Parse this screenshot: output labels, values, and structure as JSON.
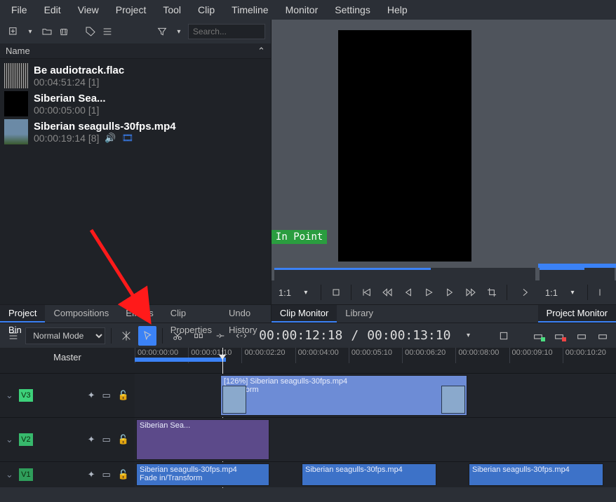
{
  "menu": [
    "File",
    "Edit",
    "View",
    "Project",
    "Tool",
    "Clip",
    "Timeline",
    "Monitor",
    "Settings",
    "Help"
  ],
  "search": {
    "placeholder": "Search..."
  },
  "bin_header": "Name",
  "clips": [
    {
      "name": "Be audiotrack.flac",
      "meta": "00:04:51:24 [1]",
      "type": "audio"
    },
    {
      "name": "Siberian Sea...",
      "meta": "00:00:05:00 [1]",
      "type": "video"
    },
    {
      "name": "Siberian seagulls-30fps.mp4",
      "meta": "00:00:19:14 [8]",
      "type": "video",
      "icons": true
    }
  ],
  "in_point": "In Point",
  "ratio_clip": "1:1",
  "ratio_proj": "1:1",
  "bin_tabs": [
    "Project Bin",
    "Compositions",
    "Effects",
    "Clip Properties",
    "Undo History"
  ],
  "mon_tabs": [
    "Clip Monitor",
    "Library"
  ],
  "proj_tab": "Project Monitor",
  "mode": "Normal Mode",
  "tc_left": "00:00:12:18",
  "tc_right": "00:00:13:10",
  "master": "Master",
  "ruler": [
    "00:00:00:00",
    "00:00:01:10",
    "00:00:02:20",
    "00:00:04:00",
    "00:00:05:10",
    "00:00:06:20",
    "00:00:08:00",
    "00:00:09:10",
    "00:00:10:20"
  ],
  "tracks": {
    "v3": {
      "tag": "V3",
      "clip": {
        "label": "[126%]  Siberian seagulls-30fps.mp4",
        "sub": "Transform"
      }
    },
    "v2": {
      "tag": "V2",
      "clip": {
        "label": "Siberian Sea..."
      }
    },
    "v1": {
      "tag": "V1",
      "clips": [
        {
          "label": "Siberian seagulls-30fps.mp4",
          "sub": "Fade in/Transform"
        },
        {
          "label": "Siberian seagulls-30fps.mp4"
        },
        {
          "label": "Siberian seagulls-30fps.mp4"
        }
      ]
    }
  }
}
